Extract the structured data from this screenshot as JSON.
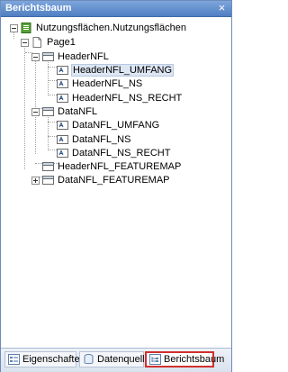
{
  "window": {
    "title": "Berichtsbaum",
    "close_glyph": "×"
  },
  "tree": {
    "root": {
      "label": "Nutzungsflächen.Nutzungsflächen",
      "icon": "report-icon"
    },
    "page": {
      "label": "Page1",
      "icon": "page-icon"
    },
    "header": {
      "label": "HeaderNFL",
      "icon": "section-icon",
      "children": [
        "HeaderNFL_UMFANG",
        "HeaderNFL_NS",
        "HeaderNFL_NS_RECHT"
      ],
      "selected": "HeaderNFL_UMFANG"
    },
    "data": {
      "label": "DataNFL",
      "icon": "section-icon",
      "children": [
        "DataNFL_UMFANG",
        "DataNFL_NS",
        "DataNFL_NS_RECHT"
      ]
    },
    "header_featuremap": {
      "label": "HeaderNFL_FEATUREMAP",
      "icon": "section-icon"
    },
    "data_featuremap": {
      "label": "DataNFL_FEATUREMAP",
      "icon": "section-icon",
      "collapsed": true
    }
  },
  "tabs": [
    {
      "label": "Eigenschaften",
      "icon": "properties-icon"
    },
    {
      "label": "Datenquelle",
      "icon": "datasource-icon"
    },
    {
      "label": "Berichtsbaum",
      "icon": "tree-icon",
      "active": true
    }
  ]
}
